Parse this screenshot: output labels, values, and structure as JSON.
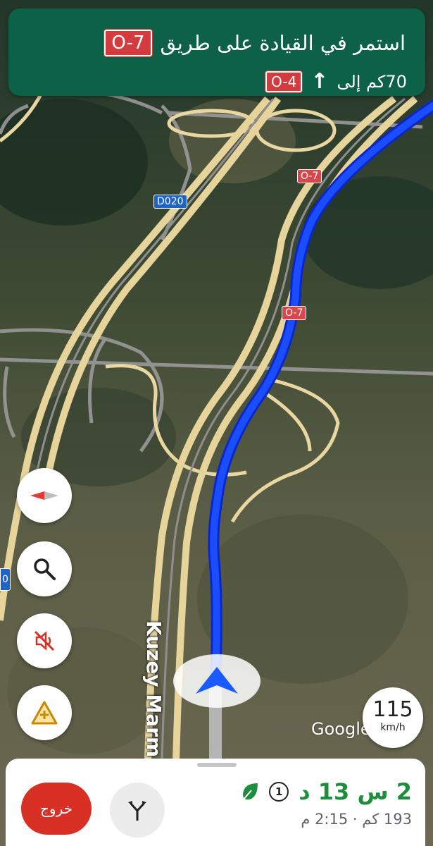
{
  "instruction": {
    "primary_text": "استمر في القيادة على طريق",
    "primary_road": "O-7",
    "distance_text": "70كم إلى",
    "next_road": "O-4",
    "direction_icon": "arrow-up-icon"
  },
  "map": {
    "road_shields": [
      {
        "label": "D020",
        "color": "#1f65c9"
      },
      {
        "label": "O-7",
        "color": "#d9474a"
      },
      {
        "label": "O-7",
        "color": "#d9474a"
      },
      {
        "label": "0",
        "color": "#1f65c9"
      }
    ],
    "road_name": "Kuzey Marm",
    "logo": "Google",
    "route_color": "#1a3df0"
  },
  "controls": {
    "compass": "compass-icon",
    "search": "search-icon",
    "mute": "volume-off-icon",
    "report": "report-incident-icon"
  },
  "speed": {
    "value": "115",
    "unit": "km/h"
  },
  "trip": {
    "exit_label": "خروج",
    "duration": "2 س 13 د",
    "toll_icon": "1",
    "distance": "193 كم",
    "separator": "·",
    "arrival": "2:15 م"
  }
}
